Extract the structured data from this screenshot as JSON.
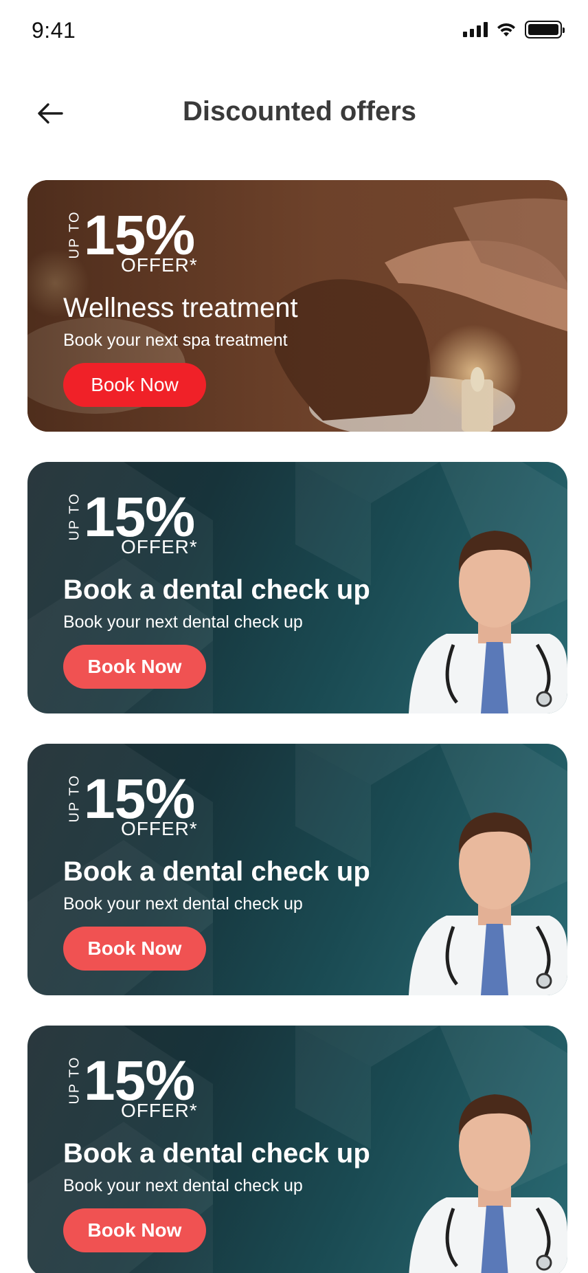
{
  "status_bar": {
    "time": "9:41"
  },
  "header": {
    "title": "Discounted offers"
  },
  "offers": [
    {
      "upto": "UP TO",
      "percent": "15%",
      "offer_label": "OFFER*",
      "title": "Wellness treatment",
      "subtitle": "Book your next spa treatment",
      "button": "Book Now"
    },
    {
      "upto": "UP TO",
      "percent": "15%",
      "offer_label": "OFFER*",
      "title": "Book a dental check up",
      "subtitle": "Book your next dental check up",
      "button": "Book Now"
    },
    {
      "upto": "UP TO",
      "percent": "15%",
      "offer_label": "OFFER*",
      "title": "Book a dental check up",
      "subtitle": "Book your next dental check up",
      "button": "Book Now"
    },
    {
      "upto": "UP TO",
      "percent": "15%",
      "offer_label": "OFFER*",
      "title": "Book a dental check up",
      "subtitle": "Book your next dental check up",
      "button": "Book Now"
    }
  ],
  "colors": {
    "spa_button": "#f02128",
    "dental_button": "#f05252",
    "dental_bg": "#17333a",
    "title": "#3a3a3a"
  },
  "icons": {
    "back": "arrow-left-icon",
    "signal": "cellular-signal-icon",
    "wifi": "wifi-icon",
    "battery": "battery-icon"
  }
}
